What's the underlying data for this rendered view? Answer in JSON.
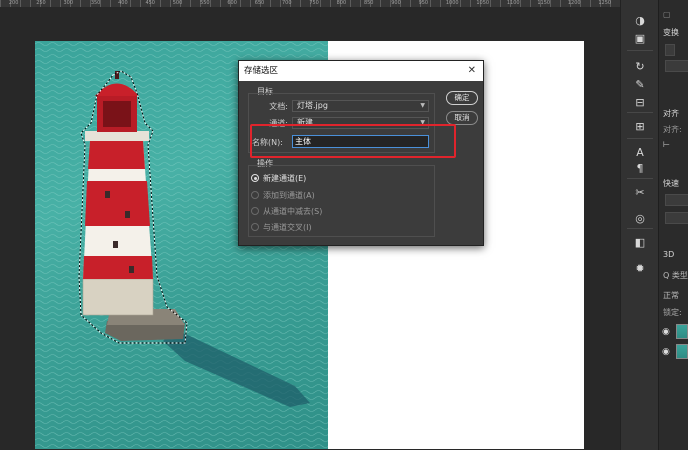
{
  "ruler": {
    "labels": [
      "200",
      "250",
      "300",
      "350",
      "400",
      "450",
      "500",
      "550",
      "600",
      "650",
      "700",
      "750",
      "800",
      "850",
      "900",
      "950",
      "1000",
      "1050",
      "1100",
      "1150",
      "1200",
      "1250"
    ]
  },
  "dialog": {
    "title": "存储选区",
    "close_icon": "close-icon",
    "target_group": "目标",
    "document_label": "文档:",
    "document_value": "灯塔.jpg",
    "channel_label": "通道:",
    "channel_value": "新建",
    "name_label": "名称(N):",
    "name_value": "主体",
    "ok_label": "确定",
    "cancel_label": "取消",
    "operation_group": "操作",
    "operations": [
      {
        "label": "新建通道(E)",
        "selected": true,
        "enabled": true
      },
      {
        "label": "添加到通道(A)",
        "selected": false,
        "enabled": false
      },
      {
        "label": "从通道中减去(S)",
        "selected": false,
        "enabled": false
      },
      {
        "label": "与通道交叉(I)",
        "selected": false,
        "enabled": false
      }
    ]
  },
  "panels": {
    "properties_title": "变换",
    "align_title": "对齐",
    "align_sub": "对齐:",
    "quick_title": "快速",
    "tab_3d": "3D",
    "search_prefix": "Q 类型",
    "blend_mode": "正常",
    "lock_label": "锁定:"
  },
  "colors": {
    "accent_blue": "#4a90d9",
    "highlight_red": "#e0242c",
    "lighthouse_red": "#c8202a",
    "sea_teal": "#3aa39a"
  }
}
